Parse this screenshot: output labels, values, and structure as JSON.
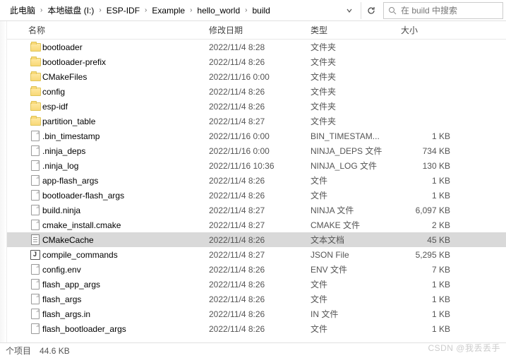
{
  "breadcrumb": [
    "此电脑",
    "本地磁盘 (I:)",
    "ESP-IDF",
    "Example",
    "hello_world",
    "build"
  ],
  "search_placeholder": "在 build 中搜索",
  "columns": {
    "name": "名称",
    "date": "修改日期",
    "type": "类型",
    "size": "大小"
  },
  "files": [
    {
      "icon": "folder",
      "name": "bootloader",
      "date": "2022/11/4 8:28",
      "type": "文件夹",
      "size": ""
    },
    {
      "icon": "folder",
      "name": "bootloader-prefix",
      "date": "2022/11/4 8:26",
      "type": "文件夹",
      "size": ""
    },
    {
      "icon": "folder",
      "name": "CMakeFiles",
      "date": "2022/11/16 0:00",
      "type": "文件夹",
      "size": ""
    },
    {
      "icon": "folder",
      "name": "config",
      "date": "2022/11/4 8:26",
      "type": "文件夹",
      "size": ""
    },
    {
      "icon": "folder",
      "name": "esp-idf",
      "date": "2022/11/4 8:26",
      "type": "文件夹",
      "size": ""
    },
    {
      "icon": "folder",
      "name": "partition_table",
      "date": "2022/11/4 8:27",
      "type": "文件夹",
      "size": ""
    },
    {
      "icon": "file",
      "name": ".bin_timestamp",
      "date": "2022/11/16 0:00",
      "type": "BIN_TIMESTAM...",
      "size": "1 KB"
    },
    {
      "icon": "file",
      "name": ".ninja_deps",
      "date": "2022/11/16 0:00",
      "type": "NINJA_DEPS 文件",
      "size": "734 KB"
    },
    {
      "icon": "file",
      "name": ".ninja_log",
      "date": "2022/11/16 10:36",
      "type": "NINJA_LOG 文件",
      "size": "130 KB"
    },
    {
      "icon": "file",
      "name": "app-flash_args",
      "date": "2022/11/4 8:26",
      "type": "文件",
      "size": "1 KB"
    },
    {
      "icon": "file",
      "name": "bootloader-flash_args",
      "date": "2022/11/4 8:26",
      "type": "文件",
      "size": "1 KB"
    },
    {
      "icon": "file",
      "name": "build.ninja",
      "date": "2022/11/4 8:27",
      "type": "NINJA 文件",
      "size": "6,097 KB"
    },
    {
      "icon": "file",
      "name": "cmake_install.cmake",
      "date": "2022/11/4 8:27",
      "type": "CMAKE 文件",
      "size": "2 KB"
    },
    {
      "icon": "text",
      "name": "CMakeCache",
      "date": "2022/11/4 8:26",
      "type": "文本文档",
      "size": "45 KB",
      "selected": true
    },
    {
      "icon": "json",
      "name": "compile_commands",
      "date": "2022/11/4 8:27",
      "type": "JSON File",
      "size": "5,295 KB"
    },
    {
      "icon": "file",
      "name": "config.env",
      "date": "2022/11/4 8:26",
      "type": "ENV 文件",
      "size": "7 KB"
    },
    {
      "icon": "file",
      "name": "flash_app_args",
      "date": "2022/11/4 8:26",
      "type": "文件",
      "size": "1 KB"
    },
    {
      "icon": "file",
      "name": "flash_args",
      "date": "2022/11/4 8:26",
      "type": "文件",
      "size": "1 KB"
    },
    {
      "icon": "file",
      "name": "flash_args.in",
      "date": "2022/11/4 8:26",
      "type": "IN 文件",
      "size": "1 KB"
    },
    {
      "icon": "file",
      "name": "flash_bootloader_args",
      "date": "2022/11/4 8:26",
      "type": "文件",
      "size": "1 KB"
    }
  ],
  "status": {
    "items_suffix": "个项目",
    "selected_size": "44.6 KB"
  },
  "watermark": "CSDN @我丢丢手"
}
